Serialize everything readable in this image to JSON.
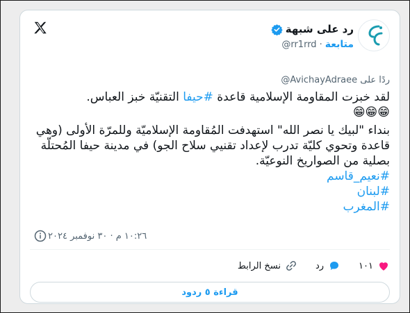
{
  "author": {
    "name": "رد على شبهة",
    "handle": "@rr1rrd",
    "follow_label": "متابعة"
  },
  "reply": {
    "prefix": "ردًا على",
    "mention": "@AvichayAdraee"
  },
  "tweet": {
    "line1_a": "لقد خبزت المقاومة الإسلامية قاعدة ",
    "line1_tag": "#حيفا",
    "line1_b": " التقنيّة خبز العباس.",
    "emojis": "😁😁😁",
    "para2": " بنداء \"لبيك يا نصر الله\" استهدفت المُقاومة الإسلاميّة  وللمرّة الأولى  (وهي قاعدة وتحوي كليّة تدرب لإعداد تقنيي سلاح الجو) في مدينة حيفا المُحتلّة بصلية من الصواريخ النوعيّة.",
    "tags": [
      "#نعيم_قاسم",
      "#لبنان",
      "#المغرب"
    ]
  },
  "timestamp": "١٠:٢٦ م · ٣٠ نوفمبر ٢٠٢٤",
  "actions": {
    "likes": "١٠١",
    "reply_label": "رد",
    "copy_link_label": "نسخ الرابط"
  },
  "read_replies_label": "قراءة ٥ ردود",
  "colors": {
    "accent": "#1d9bf0",
    "like": "#f91880",
    "text": "#0f1419",
    "muted": "#536471"
  }
}
